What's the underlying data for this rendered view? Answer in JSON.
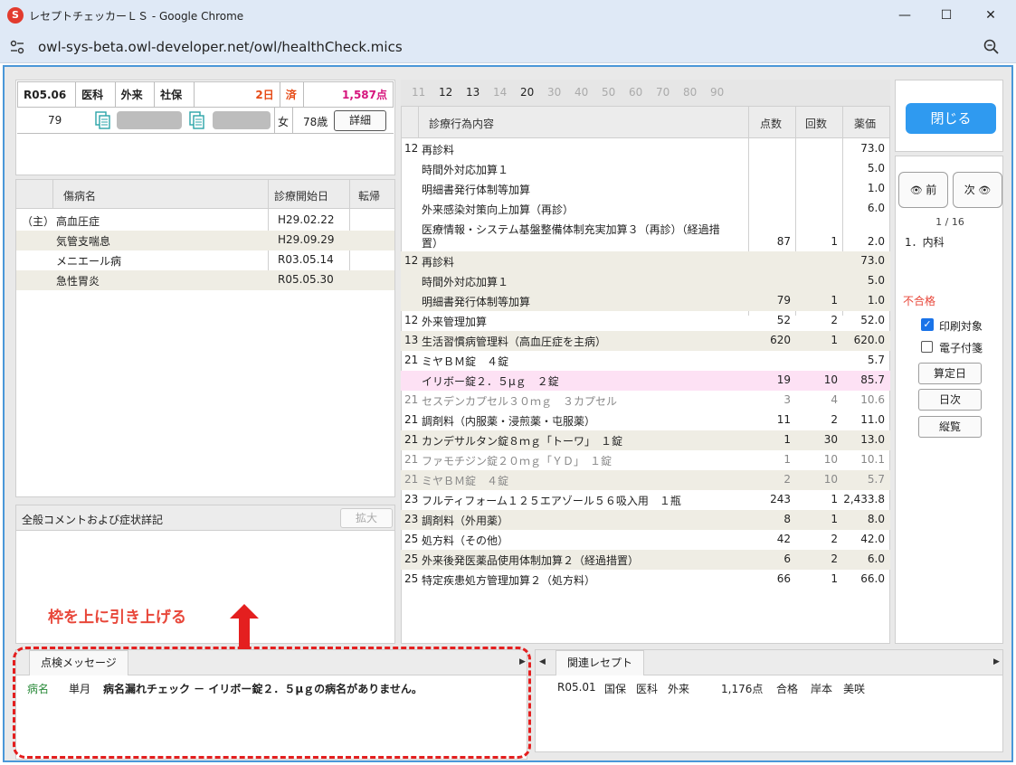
{
  "window": {
    "title": "レセプトチェッカーＬＳ - Google Chrome",
    "url": "owl-sys-beta.owl-developer.net/owl/healthCheck.mics",
    "minimize": "—",
    "maximize": "☐",
    "close": "✕"
  },
  "patient": {
    "era": "R05.06",
    "dept": "医科",
    "visit": "外来",
    "insurance": "社保",
    "days": "2日",
    "status": "済",
    "points": "1,587点",
    "id": "79",
    "sex": "女",
    "age": "78歳",
    "detail_button": "詳細"
  },
  "disease_table": {
    "headers": [
      "傷病名",
      "診療開始日",
      "転帰"
    ],
    "rows": [
      {
        "tag": "（主）",
        "name": "高血圧症",
        "date": "H29.02.22",
        "outcome": ""
      },
      {
        "tag": "",
        "name": "気管支喘息",
        "date": "H29.09.29",
        "outcome": ""
      },
      {
        "tag": "",
        "name": "メニエール病",
        "date": "R03.05.14",
        "outcome": ""
      },
      {
        "tag": "",
        "name": "急性胃炎",
        "date": "R05.05.30",
        "outcome": ""
      }
    ]
  },
  "comment": {
    "label": "全般コメントおよび症状詳記",
    "expand_button": "拡大"
  },
  "annotation": "枠を上に引き上げる",
  "check_messages": {
    "tab": "点検メッセージ",
    "rows": [
      {
        "category": "病名",
        "scope": "単月",
        "text": "病名漏れチェック － イリボー錠２．５μｇの病名がありません。"
      }
    ]
  },
  "related": {
    "tab": "関連レセプト",
    "rows": [
      {
        "era": "R05.01",
        "insurance": "国保",
        "dept": "医科",
        "visit": "外来",
        "points": "1,176点",
        "result": "合格",
        "name": "岸本　美咲"
      }
    ]
  },
  "number_tabs": [
    "11",
    "12",
    "13",
    "14",
    "20",
    "30",
    "40",
    "50",
    "60",
    "70",
    "80",
    "90"
  ],
  "treatment": {
    "headers": [
      "診療行為内容",
      "点数",
      "回数",
      "薬価"
    ],
    "rows": [
      {
        "code": "12",
        "name": "再診料",
        "pts": "",
        "cnt": "",
        "med": "73.0",
        "style": ""
      },
      {
        "code": "",
        "name": "時間外対応加算１",
        "pts": "",
        "cnt": "",
        "med": "5.0",
        "style": ""
      },
      {
        "code": "",
        "name": "明細書発行体制等加算",
        "pts": "",
        "cnt": "",
        "med": "1.0",
        "style": ""
      },
      {
        "code": "",
        "name": "外来感染対策向上加算（再診）",
        "pts": "",
        "cnt": "",
        "med": "6.0",
        "style": ""
      },
      {
        "code": "",
        "name": "医療情報・システム基盤整備体制充実加算３（再診）（経過措",
        "name2": "置）",
        "pts": "87",
        "cnt": "1",
        "med": "2.0",
        "style": ""
      },
      {
        "code": "12",
        "name": "再診料",
        "pts": "",
        "cnt": "",
        "med": "73.0",
        "style": "alt"
      },
      {
        "code": "",
        "name": "時間外対応加算１",
        "pts": "",
        "cnt": "",
        "med": "5.0",
        "style": "alt"
      },
      {
        "code": "",
        "name": "明細書発行体制等加算",
        "pts": "79",
        "cnt": "1",
        "med": "1.0",
        "style": "alt"
      },
      {
        "code": "12",
        "name": "外来管理加算",
        "pts": "52",
        "cnt": "2",
        "med": "52.0",
        "style": ""
      },
      {
        "code": "13",
        "name": "生活習慣病管理料（高血圧症を主病）",
        "pts": "620",
        "cnt": "1",
        "med": "620.0",
        "style": "alt"
      },
      {
        "code": "21",
        "name": "ミヤＢＭ錠　４錠",
        "pts": "",
        "cnt": "",
        "med": "5.7",
        "style": ""
      },
      {
        "code": "",
        "name": "イリボー錠２．５μｇ　２錠",
        "pts": "19",
        "cnt": "10",
        "med": "85.7",
        "style": "pink"
      },
      {
        "code": "21",
        "name": "セスデンカプセル３０ｍｇ　３カプセル",
        "pts": "3",
        "cnt": "4",
        "med": "10.6",
        "style": "dim"
      },
      {
        "code": "21",
        "name": "調剤料（内服薬・浸煎薬・屯服薬）",
        "pts": "11",
        "cnt": "2",
        "med": "11.0",
        "style": ""
      },
      {
        "code": "21",
        "name": "カンデサルタン錠８ｍｇ「トーワ」　１錠",
        "pts": "1",
        "cnt": "30",
        "med": "13.0",
        "style": "alt"
      },
      {
        "code": "21",
        "name": "ファモチジン錠２０ｍｇ「ＹＤ」　１錠",
        "pts": "1",
        "cnt": "10",
        "med": "10.1",
        "style": "dim"
      },
      {
        "code": "21",
        "name": "ミヤＢＭ錠　４錠",
        "pts": "2",
        "cnt": "10",
        "med": "5.7",
        "style": "dim alt"
      },
      {
        "code": "23",
        "name": "フルティフォーム１２５エアゾール５６吸入用　１瓶",
        "pts": "243",
        "cnt": "1",
        "med": "2,433.8",
        "style": ""
      },
      {
        "code": "23",
        "name": "調剤料（外用薬）",
        "pts": "8",
        "cnt": "1",
        "med": "8.0",
        "style": "alt"
      },
      {
        "code": "25",
        "name": "処方料（その他）",
        "pts": "42",
        "cnt": "2",
        "med": "42.0",
        "style": ""
      },
      {
        "code": "25",
        "name": "外来後発医薬品使用体制加算２（経過措置）",
        "pts": "6",
        "cnt": "2",
        "med": "6.0",
        "style": "alt"
      },
      {
        "code": "25",
        "name": "特定疾患処方管理加算２（処方料）",
        "pts": "66",
        "cnt": "1",
        "med": "66.0",
        "style": ""
      }
    ]
  },
  "side": {
    "close_button": "閉じる",
    "prev_button": "前",
    "next_button": "次",
    "page": "1 / 16",
    "dept_item": "1．内科",
    "result": "不合格",
    "print_label": "印刷対象",
    "print_checked": true,
    "e_label": "電子付箋",
    "e_checked": false,
    "calc_date_button": "算定日",
    "daily_button": "日次",
    "list_button": "縦覧"
  },
  "colors": {
    "accent": "#2f9af0",
    "alert": "#e8473a",
    "days": "#e64b17",
    "points": "#d6157d",
    "pink_row": "#fde1f4",
    "alt_row": "#efede4"
  }
}
